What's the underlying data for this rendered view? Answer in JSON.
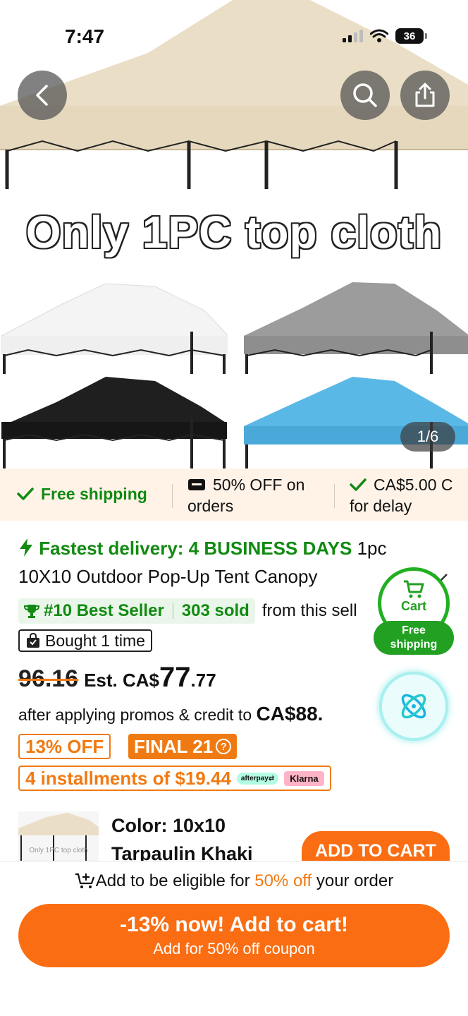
{
  "status_bar": {
    "time": "7:47",
    "battery": "36"
  },
  "hero": {
    "caption": "Only 1PC top cloth",
    "counter": "1/6",
    "canopy_colors": [
      "#eadfc6",
      "#f3f3f3",
      "#9c9c9c",
      "#1f1f1f",
      "#5ab8e6"
    ]
  },
  "perks": {
    "free_shipping": "Free shipping",
    "discount_line1": "50% OFF on",
    "discount_line2": "orders",
    "delay_line1": "CA$5.00 C",
    "delay_line2": "for delay"
  },
  "product": {
    "fast_label": "Fastest delivery: 4 BUSINESS DAYS",
    "title_start": " 1pc",
    "title_line2": "10X10 Outdoor Pop-Up Tent Canopy",
    "best_seller": "#10 Best Seller",
    "sold": "303 sold",
    "sold_suffix": "from this sell",
    "bought": "Bought 1 time"
  },
  "price": {
    "old": "96.16",
    "est_label": "Est. CA$",
    "main": "77",
    "cents": ".77",
    "promo_text": "after applying promos & credit to ",
    "promo_amount": "CA$88."
  },
  "badges": {
    "off": "13% OFF",
    "final": "FINAL 21",
    "installments": "4 installments of $19.44",
    "afterpay": "afterpay⇄",
    "klarna": "Klarna"
  },
  "sku": {
    "line1": "Color: 10x10",
    "line2": "Tarpaulin Khaki",
    "thumb_caption": "Only 1PC top cloth",
    "add_to_cart": "ADD TO CART"
  },
  "floating": {
    "cart": "Cart",
    "free_line1": "Free",
    "free_line2": "shipping"
  },
  "bottom": {
    "eligible_prefix": "Add to be eligible for ",
    "eligible_highlight": "50% off",
    "eligible_suffix": " your order",
    "cta_main": "-13% now! Add to cart!",
    "cta_sub": "Add for 50% off coupon"
  },
  "colors": {
    "accent": "#fa6d12",
    "green": "#128a12",
    "perks_bg": "#fff3e8"
  }
}
